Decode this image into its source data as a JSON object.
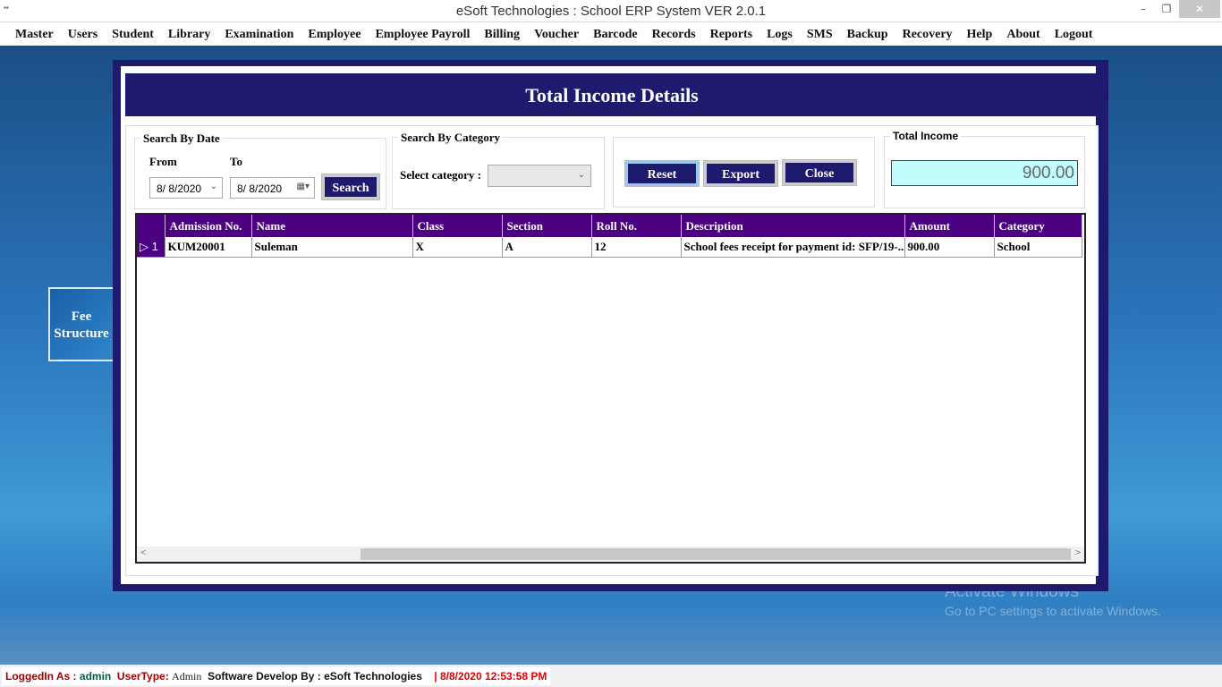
{
  "window": {
    "title": "eSoft Technologies : School ERP System VER 2.0.1",
    "app_icon": "app-icon",
    "minimize": "–",
    "restore": "❐",
    "close": "✕"
  },
  "menu": [
    "Master",
    "Users",
    "Student",
    "Library",
    "Examination",
    "Employee",
    "Employee Payroll",
    "Billing",
    "Voucher",
    "Barcode",
    "Records",
    "Reports",
    "Logs",
    "SMS",
    "Backup",
    "Recovery",
    "Help",
    "About",
    "Logout"
  ],
  "desktop": {
    "tile_line1": "Fee",
    "tile_line2": "Structure"
  },
  "dialog": {
    "title": "Total Income Details",
    "date_group": {
      "legend": "Search By Date",
      "from_label": "From",
      "to_label": "To",
      "from_value": "8/  8/2020",
      "to_value": "8/  8/2020",
      "search": "Search"
    },
    "category_group": {
      "legend": "Search By Category",
      "label": "Select category :",
      "value": ""
    },
    "buttons": {
      "reset": "Reset",
      "export": "Export",
      "close": "Close"
    },
    "total": {
      "legend": "Total Income",
      "value": "900.00"
    },
    "grid": {
      "columns": [
        "Admission No.",
        "Name",
        "Class",
        "Section",
        "Roll No.",
        "Description",
        "Amount",
        "Category"
      ],
      "rows": [
        {
          "index": "1",
          "cells": [
            "KUM20001",
            "Suleman",
            "X",
            "A",
            "12",
            "School fees receipt for payment id: SFP/19-...",
            "900.00",
            "School"
          ]
        }
      ]
    }
  },
  "watermark": {
    "line1": "Activate Windows",
    "line2": "Go to PC settings to activate Windows."
  },
  "status": {
    "logged_label": "LoggedIn As :",
    "user": "admin",
    "type_label": "UserType:",
    "type": "Admin",
    "dev": "Software Develop By : eSoft Technologies",
    "sep": "|",
    "datetime": "8/8/2020 12:53:58 PM"
  },
  "colors": {
    "navy": "#1e1a6e",
    "grid_header": "#4b0082",
    "total_bg": "#c2fdfd",
    "status_red": "#c00000"
  }
}
